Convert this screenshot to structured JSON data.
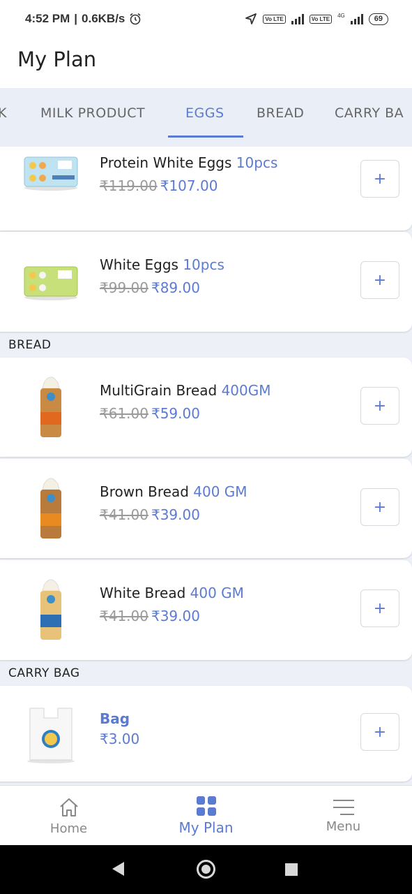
{
  "status_bar": {
    "time": "4:52 PM",
    "speed": "0.6KB/s",
    "network_label": "4G",
    "volte_label": "Vo LTE",
    "battery": "69"
  },
  "header": {
    "title": "My Plan"
  },
  "tabs": [
    "K",
    "MILK PRODUCT",
    "EGGS",
    "BREAD",
    "CARRY BA"
  ],
  "active_tab": "EGGS",
  "sections": [
    {
      "title": "",
      "items": [
        {
          "name": "Protein White Eggs",
          "unit": "10pcs",
          "old_price": "₹119.00",
          "price": "₹107.00",
          "image": "egg-tray-blue",
          "action": "+"
        },
        {
          "name": "White Eggs",
          "unit": "10pcs",
          "old_price": "₹99.00",
          "price": "₹89.00",
          "image": "egg-tray-green",
          "action": "+"
        }
      ]
    },
    {
      "title": "BREAD",
      "items": [
        {
          "name": "MultiGrain Bread",
          "unit": "400GM",
          "old_price": "₹61.00",
          "price": "₹59.00",
          "image": "bread-loaf",
          "action": "+"
        },
        {
          "name": "Brown Bread",
          "unit": "400 GM",
          "old_price": "₹41.00",
          "price": "₹39.00",
          "image": "bread-loaf",
          "action": "+"
        },
        {
          "name": "White Bread",
          "unit": "400 GM",
          "old_price": "₹41.00",
          "price": "₹39.00",
          "image": "bread-loaf",
          "action": "+"
        }
      ]
    },
    {
      "title": "CARRY BAG",
      "items": [
        {
          "name": "Bag",
          "price": "₹3.00",
          "image": "carry-bag",
          "action": "+"
        }
      ]
    }
  ],
  "bottom_nav": [
    {
      "label": "Home",
      "icon": "home-icon"
    },
    {
      "label": "My Plan",
      "icon": "grid-icon",
      "active": true
    },
    {
      "label": "Menu",
      "icon": "menu-icon"
    }
  ],
  "colors": {
    "accent": "#5b7bd2",
    "background": "#edf1f7",
    "strike": "#9a9a9a"
  }
}
